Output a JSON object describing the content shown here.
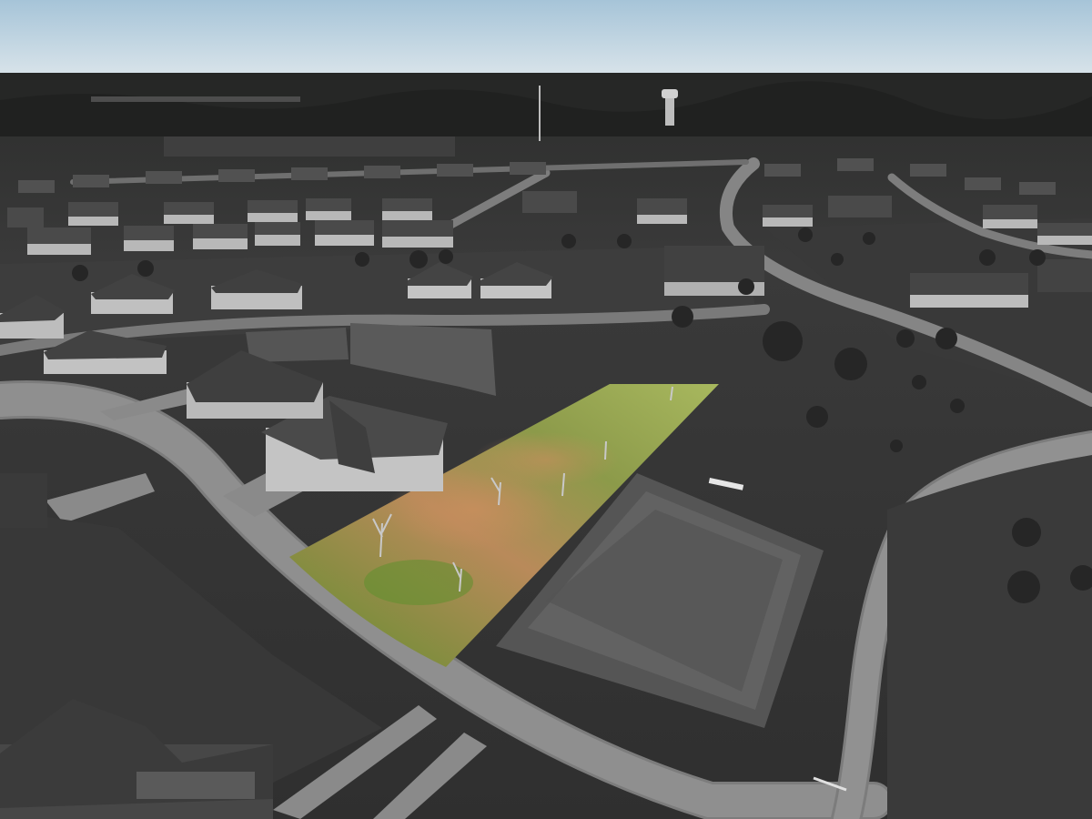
{
  "photo": {
    "style": "aerial drone photograph, desaturated except one highlighted lot",
    "colors": {
      "sky_top": "#a9c7d9",
      "sky_bottom": "#d7e3ea",
      "horizon_forest": "#2f302f",
      "ground_dark": "#353535",
      "ground_mid": "#4a4a4a",
      "road": "#8a8a8a",
      "road_edge": "#6f6f6f",
      "roof": "#454545",
      "wall": "#b9b9b9",
      "highlight_grass": "#6f9a3a",
      "highlight_dirt": "#c48a5e",
      "foundation_pad": "#5c5c5c"
    }
  }
}
